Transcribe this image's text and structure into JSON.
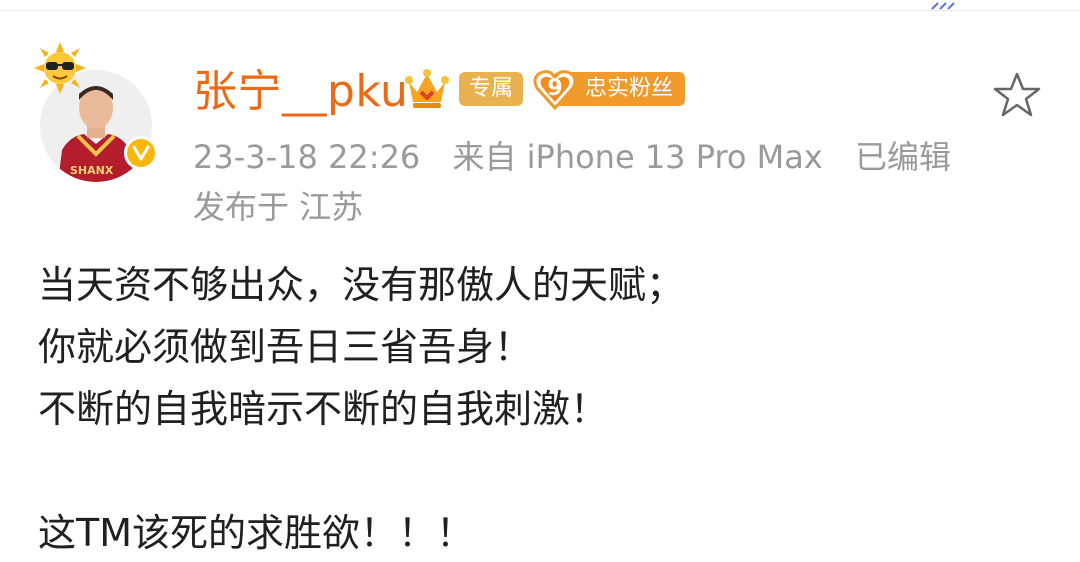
{
  "post": {
    "user": {
      "name": "张宁__pku",
      "badge_exclusive": "专属",
      "fan_level": "9",
      "fan_label": "忠实粉丝"
    },
    "meta": {
      "time": "23-3-18 22:26",
      "source": "来自 iPhone 13 Pro Max",
      "edited": "已编辑",
      "location": "发布于 江苏"
    },
    "content": [
      "当天资不够出众，没有那傲人的天赋；",
      "你就必须做到吾日三省吾身！",
      "不断的自我暗示不断的自我刺激！",
      "",
      "这TM该死的求胜欲！！！"
    ]
  },
  "colors": {
    "username": "#ec6a16",
    "exclusive_tag": "#e8b250",
    "fan_tag": "#ef9a2a",
    "verify_badge": "#f9b70e",
    "meta_text": "#9a9a9a",
    "body_text": "#202020"
  },
  "icons": {
    "sun_badge": "sunglasses-sun-icon",
    "verify": "verified-v-icon",
    "crown": "crown-icon",
    "fan_level": "heart-level-icon",
    "favorite": "star-icon"
  }
}
